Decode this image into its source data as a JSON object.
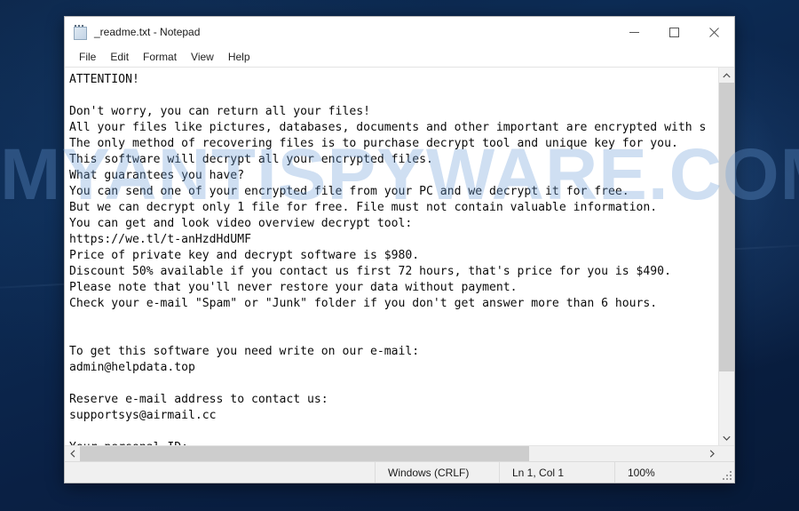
{
  "window": {
    "title": "_readme.txt - Notepad",
    "icon": "notepad-icon",
    "controls": {
      "minimize": "minimize-icon",
      "maximize": "maximize-icon",
      "close": "close-icon"
    }
  },
  "menubar": {
    "items": [
      {
        "label": "File"
      },
      {
        "label": "Edit"
      },
      {
        "label": "Format"
      },
      {
        "label": "View"
      },
      {
        "label": "Help"
      }
    ]
  },
  "editor": {
    "lines": [
      "ATTENTION!",
      "",
      "Don't worry, you can return all your files!",
      "All your files like pictures, databases, documents and other important are encrypted with s",
      "The only method of recovering files is to purchase decrypt tool and unique key for you.",
      "This software will decrypt all your encrypted files.",
      "What guarantees you have?",
      "You can send one of your encrypted file from your PC and we decrypt it for free.",
      "But we can decrypt only 1 file for free. File must not contain valuable information.",
      "You can get and look video overview decrypt tool:",
      "https://we.tl/t-anHzdHdUMF",
      "Price of private key and decrypt software is $980.",
      "Discount 50% available if you contact us first 72 hours, that's price for you is $490.",
      "Please note that you'll never restore your data without payment.",
      "Check your e-mail \"Spam\" or \"Junk\" folder if you don't get answer more than 6 hours.",
      "",
      "",
      "To get this software you need write on our e-mail:",
      "admin@helpdata.top",
      "",
      "Reserve e-mail address to contact us:",
      "supportsys@airmail.cc",
      "",
      "Your personal ID:"
    ]
  },
  "scrollbars": {
    "vertical": {
      "up": "chevron-up-icon",
      "down": "chevron-down-icon"
    },
    "horizontal": {
      "left": "chevron-left-icon",
      "right": "chevron-right-icon"
    }
  },
  "statusbar": {
    "encoding_line_ending": "Windows (CRLF)",
    "cursor_position": "Ln 1, Col 1",
    "zoom": "100%"
  },
  "watermark": {
    "text": "MYANTISPYWARE.COM",
    "color": "#699BD7"
  },
  "desktop": {
    "background_color": "#0b2447"
  }
}
